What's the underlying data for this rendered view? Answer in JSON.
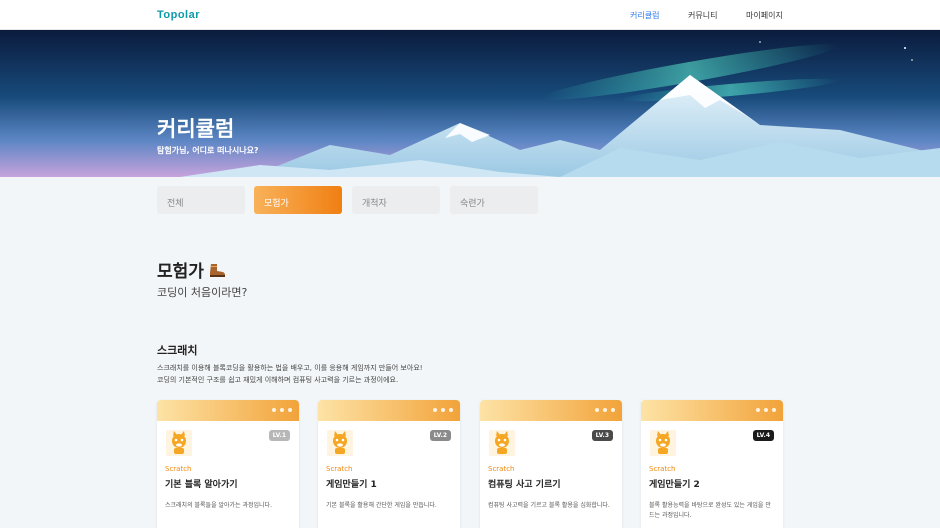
{
  "nav": {
    "logo": "Topolar",
    "items": [
      {
        "label": "커리큘럼",
        "active": true
      },
      {
        "label": "커뮤니티",
        "active": false
      },
      {
        "label": "마이페이지",
        "active": false
      }
    ]
  },
  "hero": {
    "title": "커리큘럼",
    "subtitle": "탐험가님, 어디로 떠나시나요?"
  },
  "tabs": [
    {
      "label": "전체",
      "active": false
    },
    {
      "label": "모험가",
      "active": true
    },
    {
      "label": "개척자",
      "active": false
    },
    {
      "label": "숙련가",
      "active": false
    }
  ],
  "section": {
    "title": "모험가",
    "icon": "boot-icon",
    "subtitle": "코딩이 처음이라면?"
  },
  "course": {
    "title": "스크래치",
    "desc_line1": "스크래치를 이용해 블록코딩을 활용하는 법을 배우고, 이를 응용해 게임까지 만들어 보아요!",
    "desc_line2": "코딩의 기본적인 구조를 쉽고 재밌게 이해하며 컴퓨팅 사고력을 기르는 과정이에요."
  },
  "cards": [
    {
      "level": "LV.1",
      "level_color": "#b7b7b7",
      "category": "Scratch",
      "title": "기본 블록 알아가기",
      "desc": "스크래치의 블록들을 알아가는 과정입니다."
    },
    {
      "level": "LV.2",
      "level_color": "#8a8a8a",
      "category": "Scratch",
      "title": "게임만들기 1",
      "desc": "기본 블록을 활용해 간단한 게임을 만듭니다."
    },
    {
      "level": "LV.3",
      "level_color": "#4a4a4a",
      "category": "Scratch",
      "title": "컴퓨팅 사고 기르기",
      "desc": "컴퓨팅 사고력을 기르고 블록 활용을 심화합니다."
    },
    {
      "level": "LV.4",
      "level_color": "#1b1b1b",
      "category": "Scratch",
      "title": "게임만들기 2",
      "desc": "블록 활용능력을 바탕으로 완성도 있는 게임을 만드는 과정입니다."
    }
  ],
  "colors": {
    "accent": "#f07f12",
    "nav_active": "#2f7cf0",
    "logo": "#0d9aa8"
  }
}
